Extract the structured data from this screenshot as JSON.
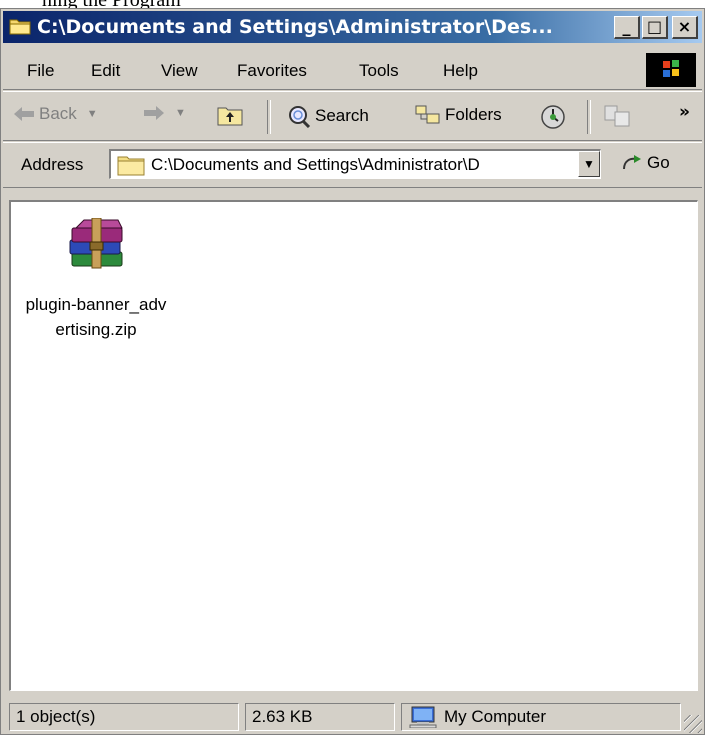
{
  "window": {
    "title": "C:\\Documents and Settings\\Administrator\\Des...",
    "title_fragment_top": "hing the Program"
  },
  "title_buttons": {
    "minimize": "_",
    "maximize": "□",
    "close": "×"
  },
  "menu": {
    "items": [
      "File",
      "Edit",
      "View",
      "Favorites",
      "Tools",
      "Help"
    ]
  },
  "toolbar": {
    "back_label": "Back",
    "search_label": "Search",
    "folders_label": "Folders",
    "more_label": "»"
  },
  "address": {
    "label": "Address",
    "value": "C:\\Documents and Settings\\Administrator\\D",
    "go_label": "Go"
  },
  "files": [
    {
      "name": "plugin-banner_advertising.zip",
      "icon": "winrar-archive-icon"
    }
  ],
  "status": {
    "objects": "1 object(s)",
    "size": "2.63 KB",
    "location": "My Computer"
  },
  "colors": {
    "title_bar_start": "#0a246a",
    "title_bar_end": "#a6caf0",
    "chrome": "#d4d0c8"
  }
}
